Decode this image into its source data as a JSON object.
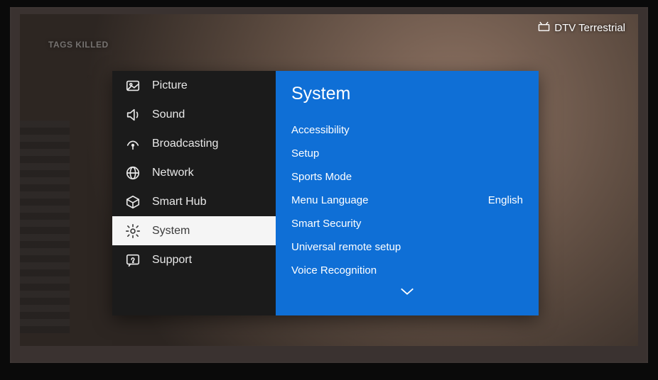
{
  "status": {
    "source_label": "DTV Terrestrial"
  },
  "bg_titles": "TAGS   KILLED",
  "sidebar": {
    "items": [
      {
        "icon": "picture-icon",
        "label": "Picture",
        "selected": false
      },
      {
        "icon": "sound-icon",
        "label": "Sound",
        "selected": false
      },
      {
        "icon": "satellite-icon",
        "label": "Broadcasting",
        "selected": false
      },
      {
        "icon": "globe-icon",
        "label": "Network",
        "selected": false
      },
      {
        "icon": "cube-icon",
        "label": "Smart Hub",
        "selected": false
      },
      {
        "icon": "gear-icon",
        "label": "System",
        "selected": true
      },
      {
        "icon": "support-icon",
        "label": "Support",
        "selected": false
      }
    ]
  },
  "panel": {
    "title": "System",
    "items": [
      {
        "label": "Accessibility",
        "value": ""
      },
      {
        "label": "Setup",
        "value": ""
      },
      {
        "label": "Sports Mode",
        "value": ""
      },
      {
        "label": "Menu Language",
        "value": "English"
      },
      {
        "label": "Smart Security",
        "value": ""
      },
      {
        "label": "Universal remote setup",
        "value": ""
      },
      {
        "label": "Voice Recognition",
        "value": ""
      }
    ]
  }
}
